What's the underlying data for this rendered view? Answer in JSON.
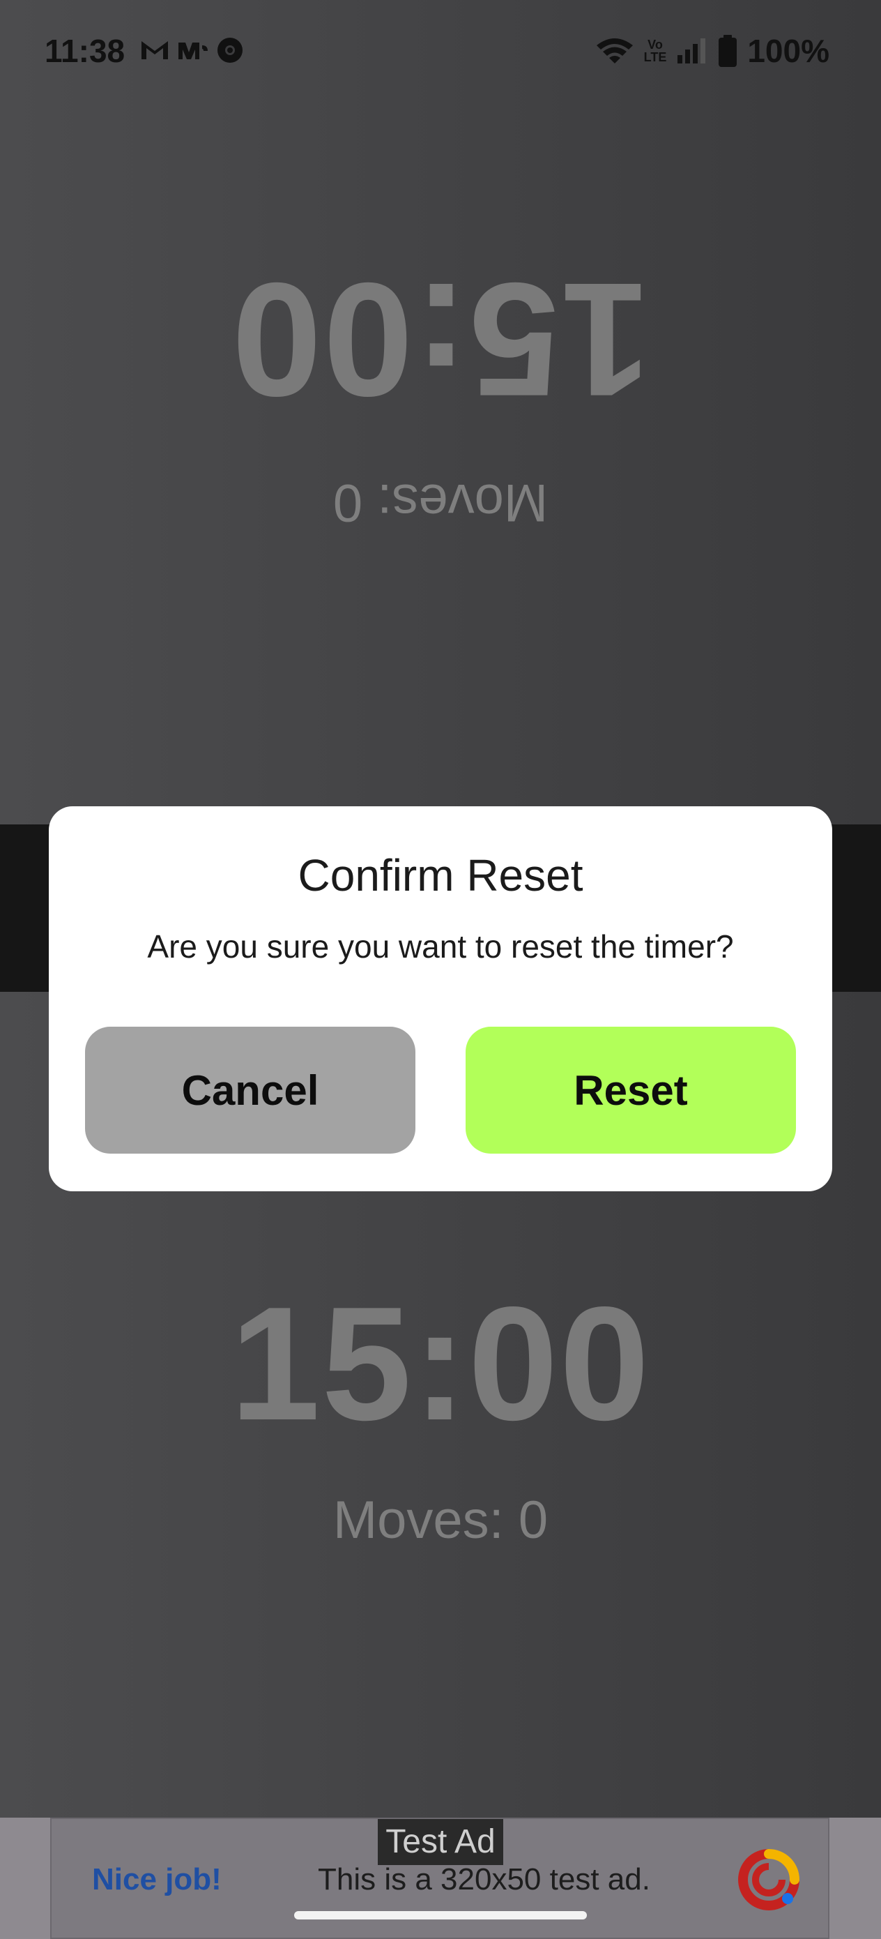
{
  "status_bar": {
    "time": "11:38",
    "notification_icons": [
      "gmail-icon",
      "mail-icon",
      "chrome-icon"
    ],
    "battery": "100%"
  },
  "top_player": {
    "moves": "Moves: 0",
    "time": "15:00"
  },
  "bottom_player": {
    "time": "15:00",
    "moves": "Moves: 0"
  },
  "dialog": {
    "title": "Confirm Reset",
    "message": "Are you sure you want to reset the timer?",
    "cancel_label": "Cancel",
    "reset_label": "Reset"
  },
  "ad": {
    "label": "Test Ad",
    "cta": "Nice job!",
    "text": "This is a 320x50 test ad."
  },
  "colors": {
    "reset_button": "#b2ff59",
    "cancel_button": "#a3a3a3",
    "dialog_bg": "#ffffff"
  }
}
